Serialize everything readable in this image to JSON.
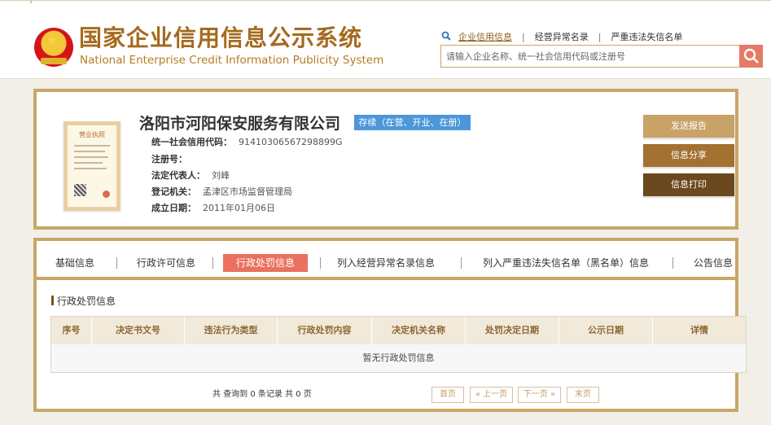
{
  "header": {
    "title": "国家企业信用信息公示系统",
    "subtitle": "National Enterprise Credit Information Publicity System",
    "quick_links": [
      "企业信用信息",
      "经营异常名录",
      "严重违法失信名单"
    ],
    "search_placeholder": "请输入企业名称、统一社会信用代码或注册号",
    "brand_color": "#a46a1d",
    "accent_color": "#e67a68"
  },
  "company": {
    "name": "洛阳市河阳保安服务有限公司",
    "status": "存续（在营、开业、在册）",
    "fields": [
      {
        "label": "统一社会信用代码：",
        "value": "91410306567298899G"
      },
      {
        "label": "注册号：",
        "value": ""
      },
      {
        "label": "法定代表人：",
        "value": "刘峰"
      },
      {
        "label": "登记机关：",
        "value": "孟津区市场监督管理局"
      },
      {
        "label": "成立日期：",
        "value": "2011年01月06日"
      }
    ],
    "buttons": [
      "发送报告",
      "信息分享",
      "信息打印"
    ],
    "license_title": "营业执照"
  },
  "tabs": [
    "基础信息",
    "行政许可信息",
    "行政处罚信息",
    "列入经营异常名录信息",
    "列入严重违法失信名单（黑名单）信息",
    "公告信息"
  ],
  "active_tab": "行政处罚信息",
  "penalty": {
    "section_title": "行政处罚信息",
    "columns": [
      "序号",
      "决定书文号",
      "违法行为类型",
      "行政处罚内容",
      "决定机关名称",
      "处罚决定日期",
      "公示日期",
      "详情"
    ],
    "empty_message": "暂无行政处罚信息",
    "summary": "共 查询到 0 条记录 共 0 页",
    "pager": [
      "首页",
      "« 上一页",
      "下一页 »",
      "末页"
    ]
  }
}
